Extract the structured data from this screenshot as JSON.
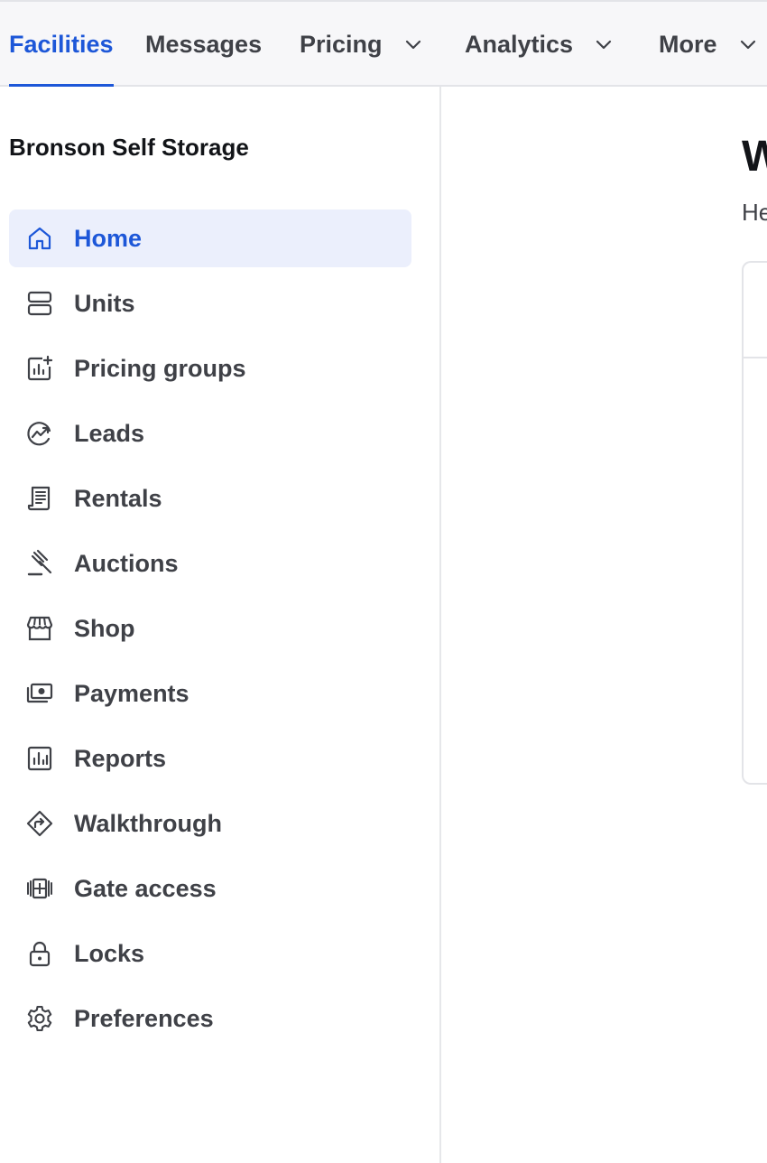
{
  "topnav": {
    "tabs": [
      {
        "label": "Facilities",
        "active": true,
        "dropdown": false
      },
      {
        "label": "Messages",
        "active": false,
        "dropdown": false
      },
      {
        "label": "Pricing",
        "active": false,
        "dropdown": true
      },
      {
        "label": "Analytics",
        "active": false,
        "dropdown": true
      },
      {
        "label": "More",
        "active": false,
        "dropdown": true
      }
    ]
  },
  "sidebar": {
    "facility_name": "Bronson Self Storage",
    "items": [
      {
        "label": "Home",
        "icon": "home-icon",
        "active": true
      },
      {
        "label": "Units",
        "icon": "units-icon",
        "active": false
      },
      {
        "label": "Pricing groups",
        "icon": "pricing-groups-icon",
        "active": false
      },
      {
        "label": "Leads",
        "icon": "leads-icon",
        "active": false
      },
      {
        "label": "Rentals",
        "icon": "rentals-icon",
        "active": false
      },
      {
        "label": "Auctions",
        "icon": "gavel-icon",
        "active": false
      },
      {
        "label": "Shop",
        "icon": "storefront-icon",
        "active": false
      },
      {
        "label": "Payments",
        "icon": "money-icon",
        "active": false
      },
      {
        "label": "Reports",
        "icon": "reports-icon",
        "active": false
      },
      {
        "label": "Walkthrough",
        "icon": "direction-sign-icon",
        "active": false
      },
      {
        "label": "Gate access",
        "icon": "gate-icon",
        "active": false
      },
      {
        "label": "Locks",
        "icon": "lock-icon",
        "active": false
      },
      {
        "label": "Preferences",
        "icon": "gear-icon",
        "active": false
      }
    ]
  },
  "main": {
    "title": "W",
    "subtitle": "He"
  },
  "colors": {
    "accent": "#1d57d8",
    "active_bg": "#ebeffc",
    "text": "#3f4147",
    "topnav_bg": "#f7f7f9",
    "border": "#e3e4e8"
  }
}
